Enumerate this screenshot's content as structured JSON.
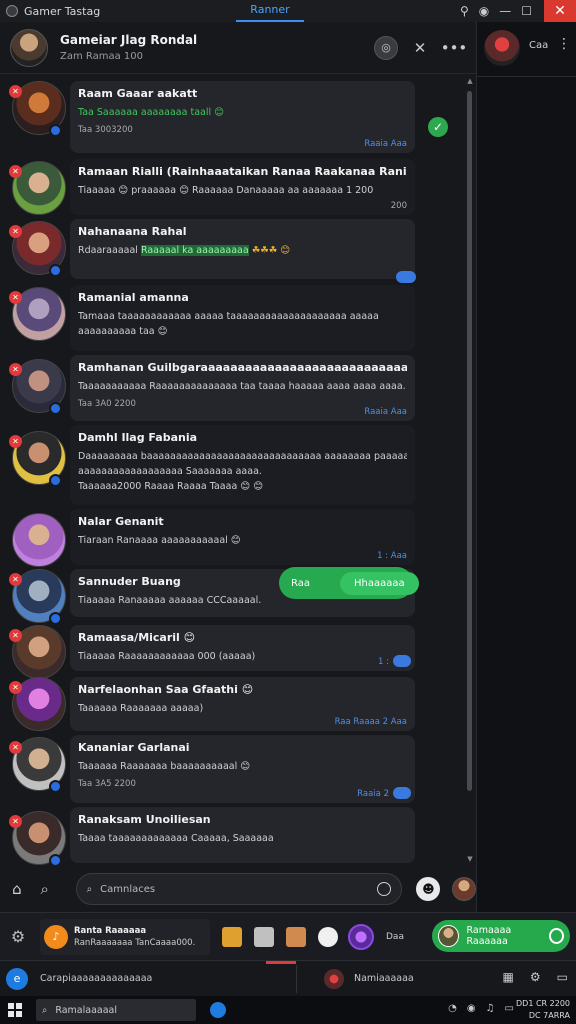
{
  "titlebar": {
    "app_title": "Gamer Tastag",
    "center_tab": "Ranner",
    "close_symbol": "✕",
    "icons": [
      "pin-icon",
      "globe-icon",
      "minimize-icon",
      "maximize-icon"
    ]
  },
  "chat_header": {
    "title": "Gameiar Jlag Rondal",
    "subtitle": "Zam Ramaa 100"
  },
  "conversations": [
    {
      "name": "Raam Gaaar aakatt",
      "line": "Taa Saaaaaa aaaaaaaa taall 😊",
      "line_green": "",
      "meta": "Taa 3003200",
      "time": "Raaia Aaa",
      "right_badge": "check"
    },
    {
      "name": "Ramaan Rialli (Rainhaaataikan Ranaa Raakanaa Ranial)",
      "line": "Tiaaaaa 😊 praaaaaa 😊 Raaaaaa Danaaaaa aa aaaaaaa 1 200",
      "line_green": "",
      "meta": "",
      "time": "200",
      "right_badge": ""
    },
    {
      "name": "Nahanaana Rahal",
      "line": "Rdaaraaaaal",
      "line_green": "Raaaaal ka aaaaaaaaa",
      "tail": "☘☘☘ 😊",
      "meta": "",
      "time": "",
      "right_badge": "read"
    },
    {
      "name": "Ramanial amanna",
      "line": "Tamaaa taaaaaaaaaaaa aaaaa taaaaaaaaaaaaaaaaaaaa aaaaa",
      "line2": "aaaaaaaaaa taa 😊",
      "meta": "",
      "time": "",
      "right_badge": ""
    },
    {
      "name": "Ramhanan Guilbgaraaaaaaaaaaaaaaaaaaaaaaaaaaaa aaaa paaaa",
      "line": "Taaaaaaaaaaa Raaaaaaaaaaaaaa taa taaaa haaaaa aaaa aaaa aaaa.",
      "meta": "Taa 3A0 2200",
      "time": "Raaia Aaa",
      "right_badge": ""
    },
    {
      "name": "Damhl Ilag Fabania",
      "line": "Daaaaaaaaa baaaaaaaaaaaaaaaaaaaaaaaaaaaaaa aaaaaaaa paaaaa",
      "line2": "aaaaaaaaaaaaaaaaaa Saaaaaaa aaaa.",
      "line3": "Taaaaaa2000 Raaaa Raaaa Taaaa 😊 😊",
      "meta": "",
      "time": "",
      "right_badge": ""
    },
    {
      "name": "Nalar Genanit",
      "line": "Tiaraan  Ranaaaa aaaaaaaaaaal 😊",
      "meta": "",
      "time": "1 : Aaa",
      "right_badge": ""
    },
    {
      "name": "Sannuder Buang",
      "line": "Tiaaaaa Ranaaaaa aaaaaa CCCaaaaal.",
      "meta": "",
      "time": "",
      "right_badge": "pill",
      "pill_left": "Raa",
      "pill_right": "Hhaaaaaa"
    },
    {
      "name": "Ramaasa/Micaril 😊",
      "line": "Tiaaaaa Raaaaaaaaaaaa 000 (aaaaa)",
      "meta": "",
      "time": "1 :",
      "right_badge": "read"
    },
    {
      "name": "Narfelaonhan Saa Gfaathi 😊",
      "line": "Taaaaaa Raaaaaaa aaaaa)",
      "meta": "",
      "time": "Raa Raaaa 2 Aaa",
      "right_badge": ""
    },
    {
      "name": "Kananiar Garlanai",
      "line": "Taaaaaa Raaaaaaa baaaaaaaaaal 😊",
      "meta": "Taa 3A5 2200",
      "time": "Raaia 2",
      "right_badge": "read"
    },
    {
      "name": "Ranaksam Unoiliesan",
      "line": "Taaaa taaaaaaaaaaaaa Caaaaa, Saaaaaa",
      "meta": "",
      "time": "",
      "right_badge": ""
    }
  ],
  "right_panel": {
    "text": "Caa"
  },
  "composer": {
    "placeholder": "Camnlaces"
  },
  "taskbar1": {
    "card_title": "Ranta Raaaaaa",
    "card_sub": "RanRaaaaaaa TanCaaaa000.",
    "small_text": "Daa",
    "pill_text": "Ramaaaa Raaaaaa"
  },
  "taskbar2": {
    "left_text": "Carapiaaaaaaaaaaaaaa",
    "right_text": "Namiaaaaaa"
  },
  "winbar": {
    "search_text": "Ramalaaaaal",
    "clock_line1": "DD1 CR 2200",
    "clock_line2": "DC 7ARRA"
  },
  "colors": {
    "accent_blue": "#3d8ef0",
    "green": "#27a950",
    "red": "#d9392f",
    "badge_red": "#e03a3a"
  }
}
